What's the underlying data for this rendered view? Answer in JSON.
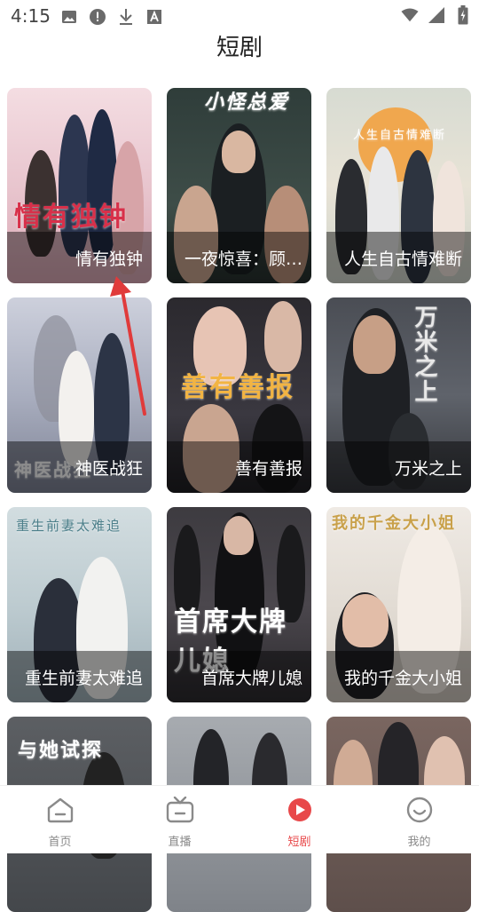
{
  "status_bar": {
    "time": "4:15",
    "left_icons": [
      "image-icon",
      "alert-icon",
      "download-icon",
      "font-icon"
    ],
    "right_icons": [
      "wifi-icon",
      "signal-icon",
      "battery-icon"
    ]
  },
  "page": {
    "title": "短剧"
  },
  "cards": [
    {
      "caption": "情有独钟",
      "poster_text": "情有独钟",
      "tint": "#e8c7cf"
    },
    {
      "caption": "一夜惊喜：顾…",
      "poster_text": "小怪总爱",
      "tint": "#3a4a45"
    },
    {
      "caption": "人生自古情难断",
      "poster_text": "人生自古情难断",
      "tint": "#d9dcd4"
    },
    {
      "caption": "神医战狂",
      "poster_text": "神医战狂",
      "tint": "#b7b9c9"
    },
    {
      "caption": "善有善报",
      "poster_text": "善有善报",
      "tint": "#2d2b30"
    },
    {
      "caption": "万米之上",
      "poster_text": "万米之上",
      "tint": "#45494f"
    },
    {
      "caption": "重生前妻太难追",
      "poster_text": "重生前妻太难追",
      "tint": "#c7d4d8"
    },
    {
      "caption": "首席大牌儿媳",
      "poster_text": "首席大牌儿媳",
      "tint": "#3c3a3f"
    },
    {
      "caption": "我的千金大小姐",
      "poster_text": "我的千金大小姐",
      "tint": "#e9e4de"
    },
    {
      "caption": "",
      "poster_text": "与她试探",
      "tint": "#5a5d61"
    },
    {
      "caption": "",
      "poster_text": "",
      "tint": "#8a8e94"
    },
    {
      "caption": "",
      "poster_text": "",
      "tint": "#6b5a55"
    }
  ],
  "bottom_nav": [
    {
      "label": "首页",
      "icon": "home-icon",
      "active": false
    },
    {
      "label": "直播",
      "icon": "tv-icon",
      "active": false
    },
    {
      "label": "短剧",
      "icon": "play-circle-icon",
      "active": true
    },
    {
      "label": "我的",
      "icon": "smiley-icon",
      "active": false
    }
  ],
  "colors": {
    "accent": "#e8484a",
    "nav_inactive": "#8a8a8a",
    "annotation_arrow": "#e03b3b"
  }
}
